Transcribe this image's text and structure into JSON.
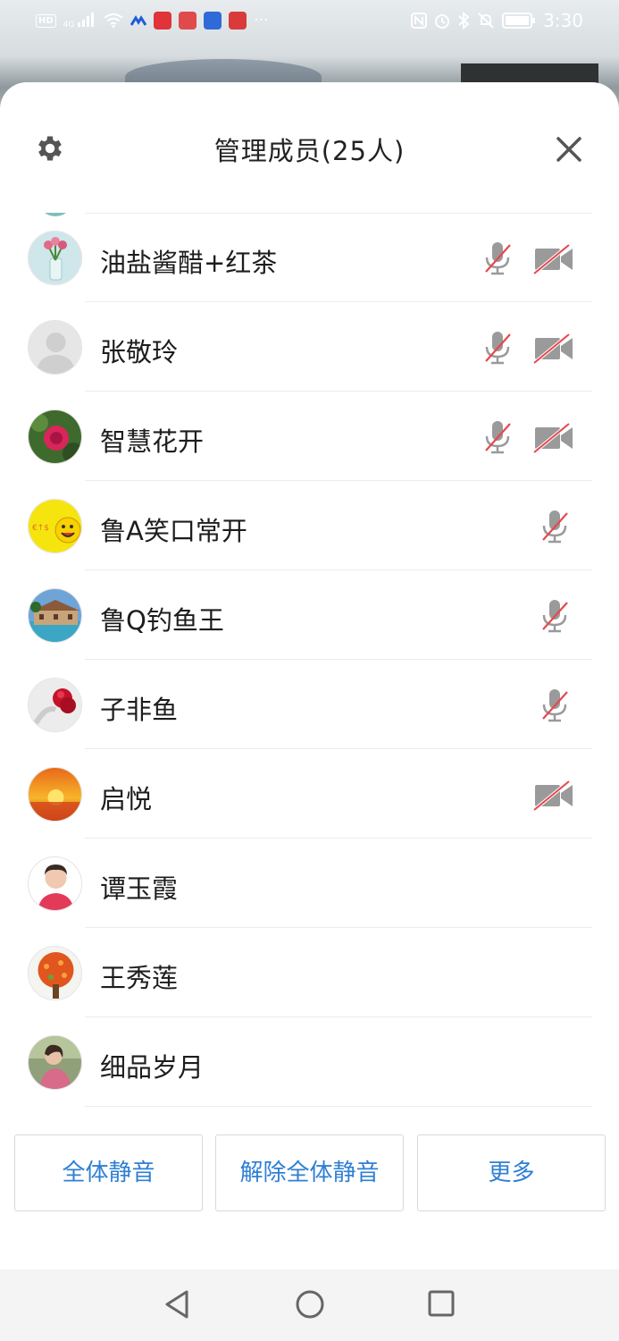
{
  "status_bar": {
    "left_badge": "HD",
    "network": "4G",
    "more": "···",
    "time": "3:30",
    "icons": [
      "hd-icon",
      "signal-icon",
      "wifi-icon",
      "app-icon",
      "app-icon",
      "app-icon",
      "app-icon",
      "nfc-icon",
      "alarm-icon",
      "bluetooth-icon",
      "mute-icon",
      "battery-icon"
    ]
  },
  "header": {
    "title": "管理成员(25人)",
    "settings_icon": "gear-icon",
    "close_icon": "close-icon"
  },
  "members": [
    {
      "name": "油盐酱醋+红茶",
      "mic_muted": true,
      "video_off": true,
      "avatar": "tulips"
    },
    {
      "name": "张敬玲",
      "mic_muted": true,
      "video_off": true,
      "avatar": "default"
    },
    {
      "name": "智慧花开",
      "mic_muted": true,
      "video_off": true,
      "avatar": "rose"
    },
    {
      "name": "鲁A笑口常开",
      "mic_muted": true,
      "video_off": false,
      "avatar": "smiley"
    },
    {
      "name": "鲁Q钓鱼王",
      "mic_muted": true,
      "video_off": false,
      "avatar": "house"
    },
    {
      "name": "子非鱼",
      "mic_muted": true,
      "video_off": false,
      "avatar": "roses"
    },
    {
      "name": "启悦",
      "mic_muted": false,
      "video_off": true,
      "avatar": "sunset"
    },
    {
      "name": "谭玉霞",
      "mic_muted": false,
      "video_off": false,
      "avatar": "portrait"
    },
    {
      "name": "王秀莲",
      "mic_muted": false,
      "video_off": false,
      "avatar": "tree"
    },
    {
      "name": "细品岁月",
      "mic_muted": false,
      "video_off": false,
      "avatar": "photo"
    }
  ],
  "actions": {
    "mute_all": "全体静音",
    "unmute_all": "解除全体静音",
    "more": "更多"
  },
  "colors": {
    "accent": "#2f7fd3",
    "muted_slash": "#e5484d",
    "icon_gray": "#9a9a9a"
  },
  "nav": {
    "back_icon": "back-triangle-icon",
    "home_icon": "home-circle-icon",
    "recents_icon": "recents-square-icon"
  }
}
